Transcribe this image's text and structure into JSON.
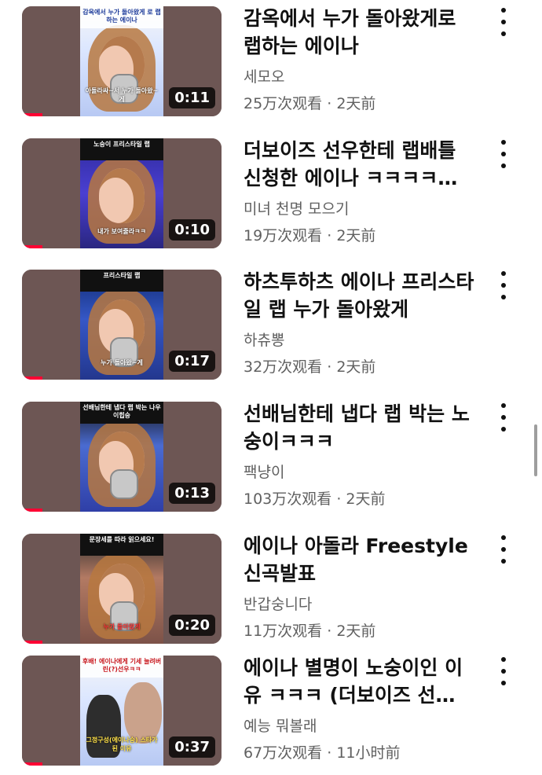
{
  "videos": [
    {
      "thumb_caption": "감옥에서 누가 돌아왔게 로 랩하는 에이나",
      "thumb_sub": "아돌라싸~서 누가 돌아왔~게",
      "duration": "0:11",
      "title": "감옥에서 누가 돌아왔게로 랩하는 에이나",
      "channel": "세모오",
      "views": "25万次观看",
      "age": "2天前"
    },
    {
      "thumb_caption": "노숭이 프리스타일 랩",
      "thumb_sub": "내가 보여줄라ㅋㅋ",
      "duration": "0:10",
      "title": "더보이즈 선우한테 랩배틀 신청한 에이나 ㅋㅋㅋㅋ…",
      "channel": "미녀 천명 모으기",
      "views": "19万次观看",
      "age": "2天前"
    },
    {
      "thumb_caption": "프리스타일 랩",
      "thumb_sub": "누가 돌아왔~게",
      "duration": "0:17",
      "title": "하츠투하츠 에이나 프리스타일 랩 누가 돌아왔게",
      "channel": "하츄뽕",
      "views": "32万次观看",
      "age": "2天前"
    },
    {
      "thumb_caption": "선배님한테 냅다 랩 박는 나우이힙숭",
      "thumb_sub": "",
      "duration": "0:13",
      "title": "선배님한테 냅다 랩 박는 노숭이ㅋㅋㅋ",
      "channel": "팩냥이",
      "views": "103万次观看",
      "age": "2天前"
    },
    {
      "thumb_caption": "문장세를 따라 읽으세요!",
      "thumb_sub": "누가 돌아왔게",
      "duration": "0:20",
      "title": "에이나 아돌라 Freestyle 신곡발표",
      "channel": "반갑숭니다",
      "views": "11万次观看",
      "age": "2天前"
    },
    {
      "thumb_caption": "후배! 에이나에게 기세 눌려버린(?)선우ㅋㅋ",
      "thumb_sub": "그정구성(에이나숭) 스타가 된 이유",
      "duration": "0:37",
      "title": "에이나 별명이 노숭이인 이유 ㅋㅋㅋ (더보이즈 선…",
      "channel": "예능 뭐볼래",
      "views": "67万次观看",
      "age": "11小时前"
    }
  ],
  "separator": "·",
  "colors": {
    "progress": "#ff0033",
    "meta_text": "#606060",
    "title_text": "#111111"
  }
}
